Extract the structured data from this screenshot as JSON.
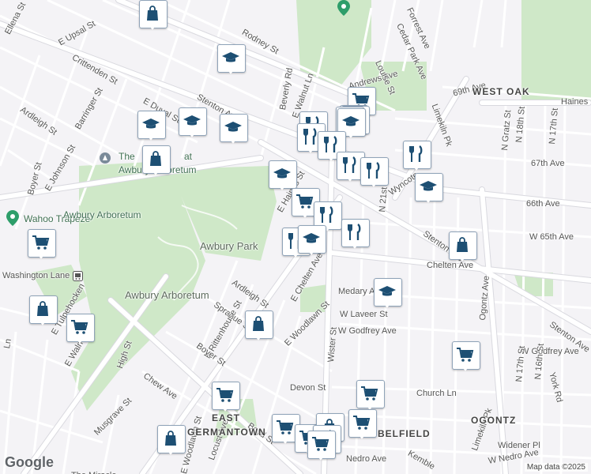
{
  "colors": {
    "background": "#f4f3f6",
    "park": "#cfe8c8",
    "road": "#ffffff",
    "road_edge": "#d8d8de",
    "marker_icon": "#1d4f73"
  },
  "streets": [
    "Ellena St",
    "E Upsal St",
    "Crittenden St",
    "Rodney St",
    "E Duval St",
    "Stenton Ave",
    "Beverly Rd",
    "E Walnut Ln",
    "Andrews Ave",
    "Louise St",
    "Cedar Park Ave",
    "Forrest Ave",
    "69th Ave",
    "Limekiln Pk",
    "Haines",
    "Ardleigh St",
    "Barringer St",
    "E Johnson St",
    "Boyer St",
    "E Haines St",
    "67th Ave",
    "66th Ave",
    "W 65th Ave",
    "Chelten Ave",
    "E Chelten Ave",
    "Ardleigh St",
    "N 21st St",
    "N Gratz St",
    "N 18th St",
    "N 17th St",
    "Ogontz Ave",
    "Medary Ave",
    "W Laveer St",
    "W Godfrey Ave",
    "W Godfrey Ave",
    "Stenton Ave",
    "E Woodlawn St",
    "Sprague St",
    "E Rittenhouse St",
    "Boyer St",
    "Chew Ave",
    "E Tulpehocken",
    "E Walnut Ln",
    "High St",
    "Devon St",
    "Church Ln",
    "Boyd St",
    "E Woodlawn St",
    "Musgrave St",
    "Locust Ave",
    "Widener Pl",
    "W Nedro Ave",
    "Nedro Ave",
    "Kemble",
    "N 17th St",
    "N 16th St",
    "York Rd",
    "Wister St",
    "Limekiln Pk",
    "Wyncote",
    "Stenton Ave",
    "Ln"
  ],
  "places": [
    "The",
    "at",
    "Awbury Arboretum",
    "Wahoo Trapeze",
    "Awbury Arboretum",
    "Awbury Park",
    "Awbury Arboretum",
    "Washington Lane",
    "WEST OAK",
    "EAST",
    "GERMANTOWN",
    "BELFIELD",
    "OGONTZ",
    "The Miracle"
  ],
  "markers": [
    "shopping-bag",
    "graduation-cap",
    "graduation-cap",
    "graduation-cap",
    "graduation-cap",
    "shopping-bag",
    "shopping-cart",
    "shopping-cart",
    "shopping-cart",
    "shopping-cart",
    "graduation-cap",
    "restaurant",
    "restaurant",
    "restaurant",
    "restaurant",
    "restaurant",
    "restaurant",
    "graduation-cap",
    "shopping-cart",
    "restaurant",
    "restaurant",
    "restaurant",
    "graduation-cap",
    "graduation-cap",
    "shopping-cart",
    "shopping-bag",
    "shopping-bag",
    "graduation-cap",
    "shopping-cart",
    "shopping-bag",
    "shopping-cart",
    "shopping-cart",
    "shopping-cart",
    "shopping-bag",
    "shopping-cart",
    "shopping-cart",
    "shopping-cart",
    "shopping-bag",
    "restaurant",
    "shopping-cart"
  ],
  "attribution": "Map data ©2025",
  "logo": "Google"
}
